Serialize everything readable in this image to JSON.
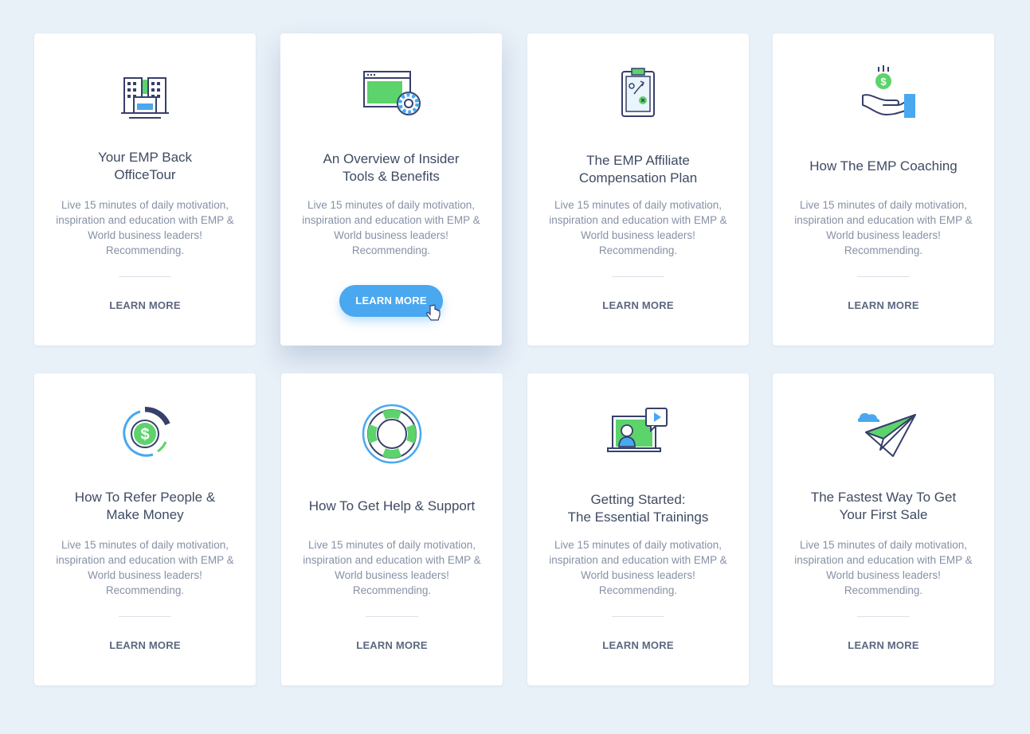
{
  "colors": {
    "background": "#e8f0f8",
    "green": "#5dd36b",
    "blue": "#49a8ef",
    "navy": "#37406a",
    "title": "#3f4b62",
    "text": "#8691a5"
  },
  "cards": [
    {
      "icon": "office-building-icon",
      "title": "Your EMP Back\nOfficeTour",
      "desc": "Live 15 minutes of daily motivation, inspiration and education with EMP & World business leaders! Recommending.",
      "cta": "LEARN MORE"
    },
    {
      "icon": "browser-settings-icon",
      "title": "An Overview of Insider\nTools & Benefits",
      "desc": "Live 15 minutes of daily motivation, inspiration and education with EMP & World business leaders! Recommending.",
      "cta": "LEARN MORE"
    },
    {
      "icon": "clipboard-plan-icon",
      "title": "The EMP Affiliate\nCompensation Plan",
      "desc": "Live 15 minutes of daily motivation, inspiration and education with EMP & World business leaders! Recommending.",
      "cta": "LEARN MORE"
    },
    {
      "icon": "hand-coin-icon",
      "title": "How The EMP Coaching",
      "desc": "Live 15 minutes of daily motivation, inspiration and education with EMP & World business leaders! Recommending.",
      "cta": "LEARN MORE"
    },
    {
      "icon": "dollar-chart-icon",
      "title": "How To Refer People &\nMake Money",
      "desc": "Live 15 minutes of daily motivation, inspiration and education with EMP & World business leaders! Recommending.",
      "cta": "LEARN MORE"
    },
    {
      "icon": "lifebuoy-icon",
      "title": "How To Get Help & Support",
      "desc": "Live 15 minutes of daily motivation, inspiration and education with EMP & World business leaders! Recommending.",
      "cta": "LEARN MORE"
    },
    {
      "icon": "video-training-icon",
      "title": "Getting Started:\nThe Essential Trainings",
      "desc": "Live 15 minutes of daily motivation, inspiration and education with EMP & World business leaders! Recommending.",
      "cta": "LEARN MORE"
    },
    {
      "icon": "paper-plane-icon",
      "title": "The Fastest Way To Get\nYour First Sale",
      "desc": "Live 15 minutes of daily motivation, inspiration and education with EMP & World business leaders! Recommending.",
      "cta": "LEARN MORE"
    }
  ]
}
